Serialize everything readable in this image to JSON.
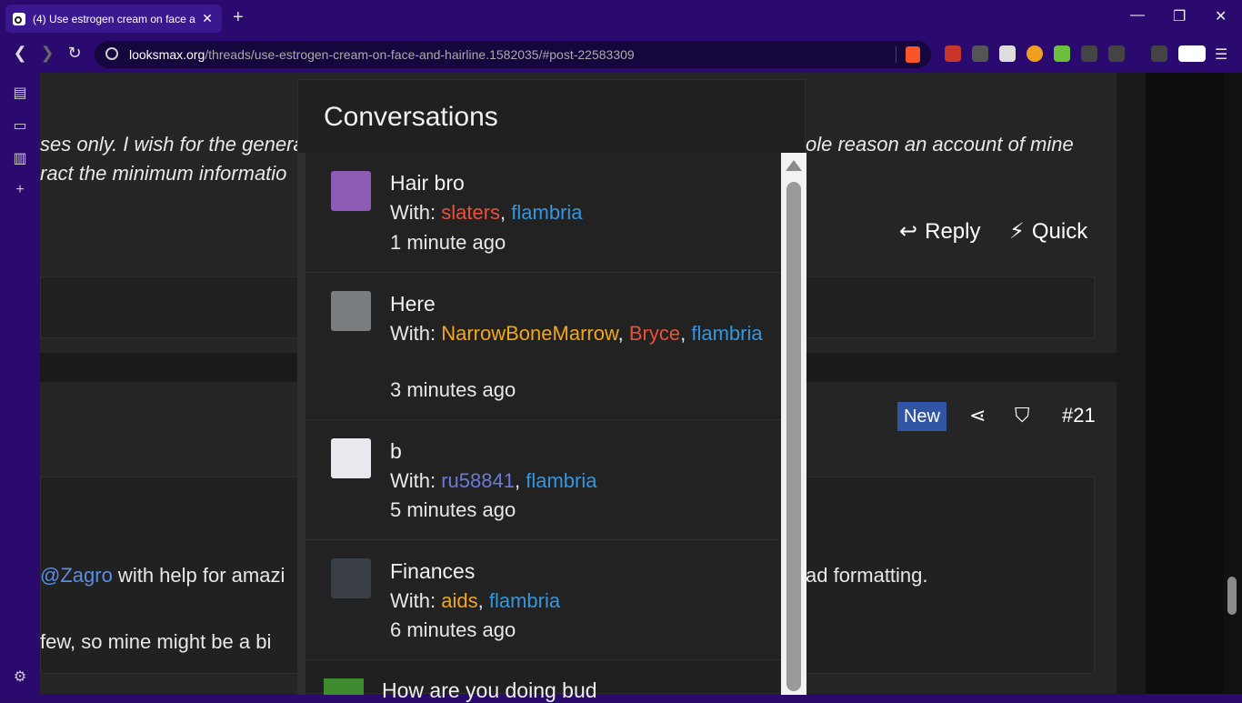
{
  "browser": {
    "tab_title": "(4) Use estrogen cream on face a",
    "url_domain": "looksmax.org",
    "url_path": "/threads/use-estrogen-cream-on-face-and-hairline.1582035/#post-22583309",
    "new_tab": "+",
    "minimize": "—",
    "restore": "❐",
    "close": "✕"
  },
  "page": {
    "italic_line1": "ses only. I wish for the genera",
    "italic_line1_right": "ole reason an account of mine",
    "italic_line2": "ract the minimum informatio",
    "reply_label": "Reply",
    "quick_label": "Quick",
    "new_badge": "New",
    "post_number": "#21",
    "mention": "@Zagro",
    "body_line1": " with help for amazi",
    "body_line1_right": "ad formatting.",
    "body_line2": "few, so mine might be a bi"
  },
  "popup": {
    "title": "Conversations",
    "conversations": [
      {
        "name": "Hair bro",
        "with_label": "With: ",
        "participants": [
          {
            "n": "slaters",
            "c": "red"
          },
          {
            "n": "flambria",
            "c": "blue"
          }
        ],
        "time": "1 minute ago"
      },
      {
        "name": "Here",
        "with_label": "With: ",
        "participants": [
          {
            "n": "NarrowBoneMarrow",
            "c": "orange"
          },
          {
            "n": "Bryce",
            "c": "red"
          },
          {
            "n": "flambria",
            "c": "blue"
          }
        ],
        "time": "3 minutes ago"
      },
      {
        "name": "b",
        "with_label": "With: ",
        "participants": [
          {
            "n": "ru58841",
            "c": "purple"
          },
          {
            "n": "flambria",
            "c": "blue"
          }
        ],
        "time": "5 minutes ago"
      },
      {
        "name": "Finances",
        "with_label": "With: ",
        "participants": [
          {
            "n": "aids",
            "c": "orange"
          },
          {
            "n": "flambria",
            "c": "blue"
          }
        ],
        "time": "6 minutes ago"
      }
    ],
    "partial_title": "How are you doing bud"
  },
  "colors": {
    "red": "#e8523a",
    "blue": "#3296e0",
    "orange": "#f2a71b",
    "purple": "#6a7ad8"
  }
}
